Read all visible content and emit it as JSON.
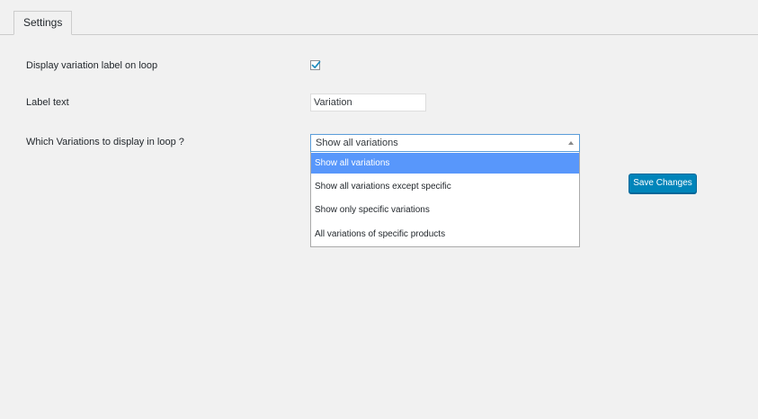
{
  "tabs": [
    {
      "label": "Settings",
      "active": true
    }
  ],
  "fields": {
    "display_label": {
      "label": "Display variation label on loop",
      "checked": true
    },
    "label_text": {
      "label": "Label text",
      "value": "Variation"
    },
    "variations": {
      "label": "Which Variations to display in loop ?",
      "selected": "Show all variations",
      "options": [
        "Show all variations",
        "Show all variations except specific",
        "Show only specific variations",
        "All variations of specific products"
      ]
    }
  },
  "actions": {
    "save_label": "Save Changes"
  },
  "colors": {
    "background": "#f1f1f1",
    "primary_button": "#0085ba",
    "highlight_option": "#5897fb",
    "focus_border": "#5b9dd9"
  }
}
